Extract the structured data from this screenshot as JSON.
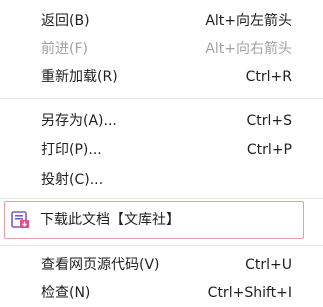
{
  "menu": {
    "back": {
      "label": "返回(B)",
      "shortcut": "Alt+向左箭头"
    },
    "forward": {
      "label": "前进(F)",
      "shortcut": "Alt+向右箭头"
    },
    "reload": {
      "label": "重新加载(R)",
      "shortcut": "Ctrl+R"
    },
    "save_as": {
      "label": "另存为(A)...",
      "shortcut": "Ctrl+S"
    },
    "print": {
      "label": "打印(P)...",
      "shortcut": "Ctrl+P"
    },
    "cast": {
      "label": "投射(C)..."
    },
    "extension": {
      "label": "下载此文档【文库社】",
      "icon": "extension-icon"
    },
    "view_source": {
      "label": "查看网页源代码(V)",
      "shortcut": "Ctrl+U"
    },
    "inspect": {
      "label": "检查(N)",
      "shortcut": "Ctrl+Shift+I"
    }
  },
  "colors": {
    "text": "#1f1f1f",
    "disabled_text": "#a3a3a3",
    "divider": "#e6e6e6",
    "highlight_border": "#e6a0a0",
    "icon_purple": "#7b5cc7",
    "icon_pink": "#e04c8c"
  }
}
